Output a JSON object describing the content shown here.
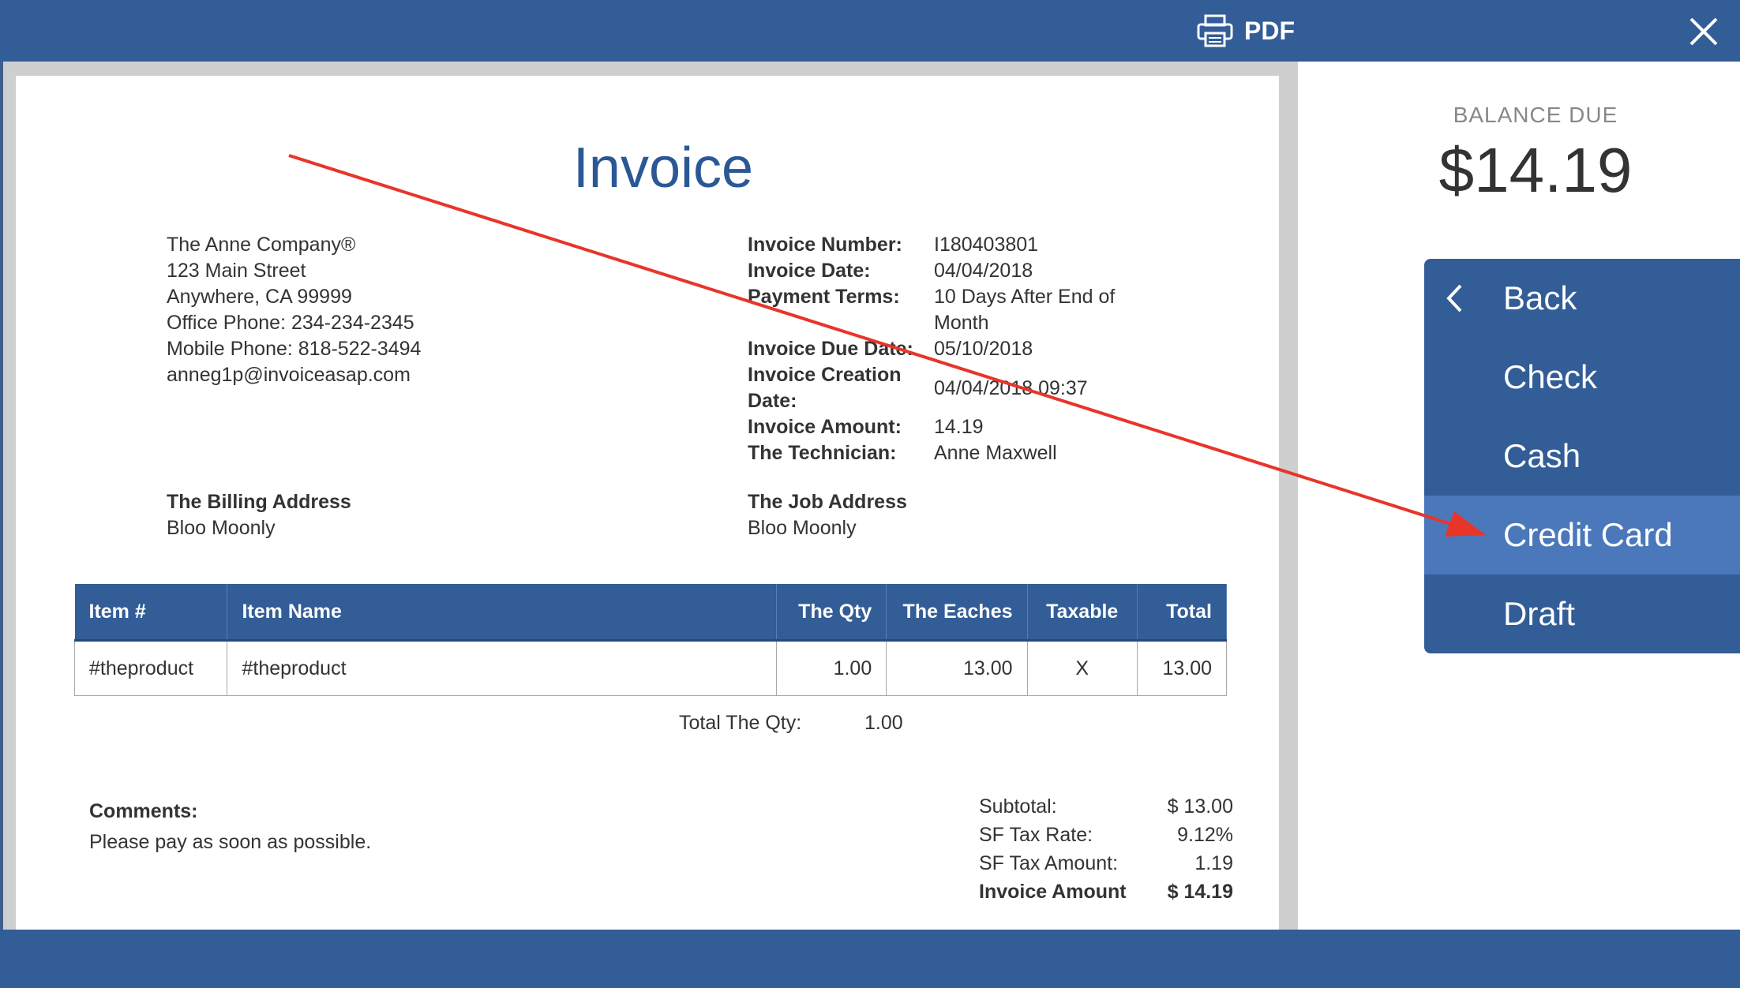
{
  "topbar": {
    "pdf_label": "PDF"
  },
  "invoice": {
    "title": "Invoice",
    "company": {
      "name": "The Anne Company®",
      "street": "123 Main Street",
      "city": "Anywhere, CA 99999",
      "office_phone": "Office Phone: 234-234-2345",
      "mobile_phone": "Mobile Phone: 818-522-3494",
      "email": "anneg1p@invoiceasap.com"
    },
    "meta": [
      {
        "key": "Invoice Number:",
        "value": "I180403801"
      },
      {
        "key": "Invoice Date:",
        "value": "04/04/2018"
      },
      {
        "key": "Payment Terms:",
        "value": "10 Days After End of Month"
      },
      {
        "key": "Invoice Due Date:",
        "value": "05/10/2018"
      },
      {
        "key": "Invoice Creation Date:",
        "value": "04/04/2018 09:37"
      },
      {
        "key": "Invoice Amount:",
        "value": "14.19"
      },
      {
        "key": "The Technician:",
        "value": "Anne Maxwell"
      }
    ],
    "billing": {
      "heading": "The Billing Address",
      "name": "Bloo Moonly"
    },
    "job": {
      "heading": "The Job Address",
      "name": "Bloo Moonly"
    },
    "table": {
      "headers": [
        "Item #",
        "Item Name",
        "The Qty",
        "The Eaches",
        "Taxable",
        "Total"
      ],
      "rows": [
        [
          "#theproduct",
          "#theproduct",
          "1.00",
          "13.00",
          "X",
          "13.00"
        ]
      ]
    },
    "total_qty": {
      "label": "Total The Qty:",
      "value": "1.00"
    },
    "comments": {
      "heading": "Comments:",
      "text": "Please pay as soon as possible."
    },
    "totals": [
      {
        "label": "Subtotal:",
        "value": "$ 13.00"
      },
      {
        "label": "SF Tax Rate:",
        "value": "9.12%"
      },
      {
        "label": "SF Tax Amount:",
        "value": "1.19"
      },
      {
        "label": "Invoice Amount",
        "value": "$ 14.19"
      }
    ]
  },
  "balance": {
    "label": "BALANCE DUE",
    "amount": "$14.19"
  },
  "payment_menu": {
    "items": [
      {
        "label": "Back",
        "icon": "chevron-left-icon"
      },
      {
        "label": "Check"
      },
      {
        "label": "Cash"
      },
      {
        "label": "Credit Card",
        "active": true
      },
      {
        "label": "Draft"
      }
    ]
  },
  "colors": {
    "brand": "#325d96",
    "active": "#4a78ba",
    "title": "#2a5896",
    "annotation_arrow": "#e8352a"
  }
}
